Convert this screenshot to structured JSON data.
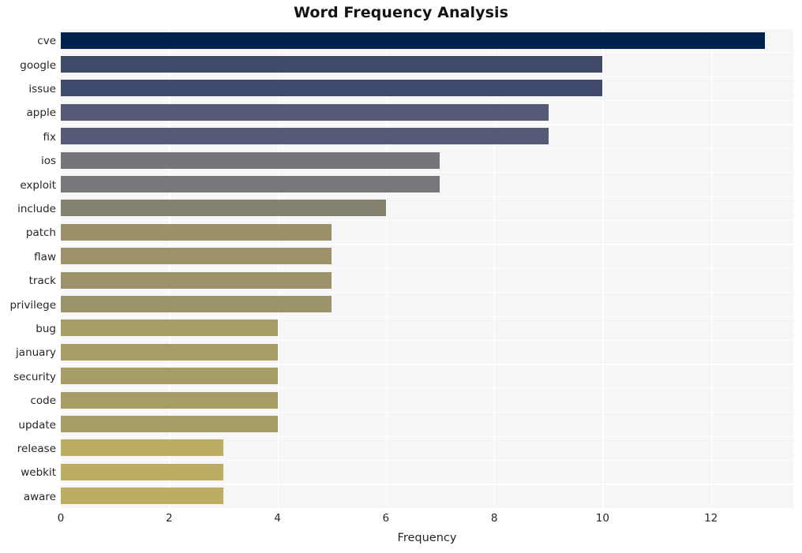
{
  "chart_data": {
    "type": "bar",
    "orientation": "horizontal",
    "title": "Word Frequency Analysis",
    "xlabel": "Frequency",
    "ylabel": "",
    "xlim": [
      0,
      13.52
    ],
    "xticks": [
      0,
      2,
      4,
      6,
      8,
      10,
      12
    ],
    "xtick_labels": [
      "0",
      "2",
      "4",
      "6",
      "8",
      "10",
      "12"
    ],
    "grid": true,
    "grid_color": "#ffffff",
    "plot_background": "#f6f6f6",
    "legend": null,
    "categories": [
      "cve",
      "google",
      "issue",
      "apple",
      "fix",
      "ios",
      "exploit",
      "include",
      "patch",
      "flaw",
      "track",
      "privilege",
      "bug",
      "january",
      "security",
      "code",
      "update",
      "release",
      "webkit",
      "aware"
    ],
    "values": [
      13,
      10,
      10,
      9,
      9,
      7,
      7,
      6,
      5,
      5,
      5,
      5,
      4,
      4,
      4,
      4,
      4,
      3,
      3,
      3
    ],
    "bar_colors": [
      "#00224e",
      "#3f4a69",
      "#404a6e",
      "#545a75",
      "#555b77",
      "#75767a",
      "#76777b",
      "#84826f",
      "#9a9169",
      "#9b9269",
      "#9b9269",
      "#9b9369",
      "#a79c66",
      "#a79c66",
      "#a79c66",
      "#a79c66",
      "#a89d66",
      "#bdad62",
      "#bdad62",
      "#bdad62"
    ]
  }
}
